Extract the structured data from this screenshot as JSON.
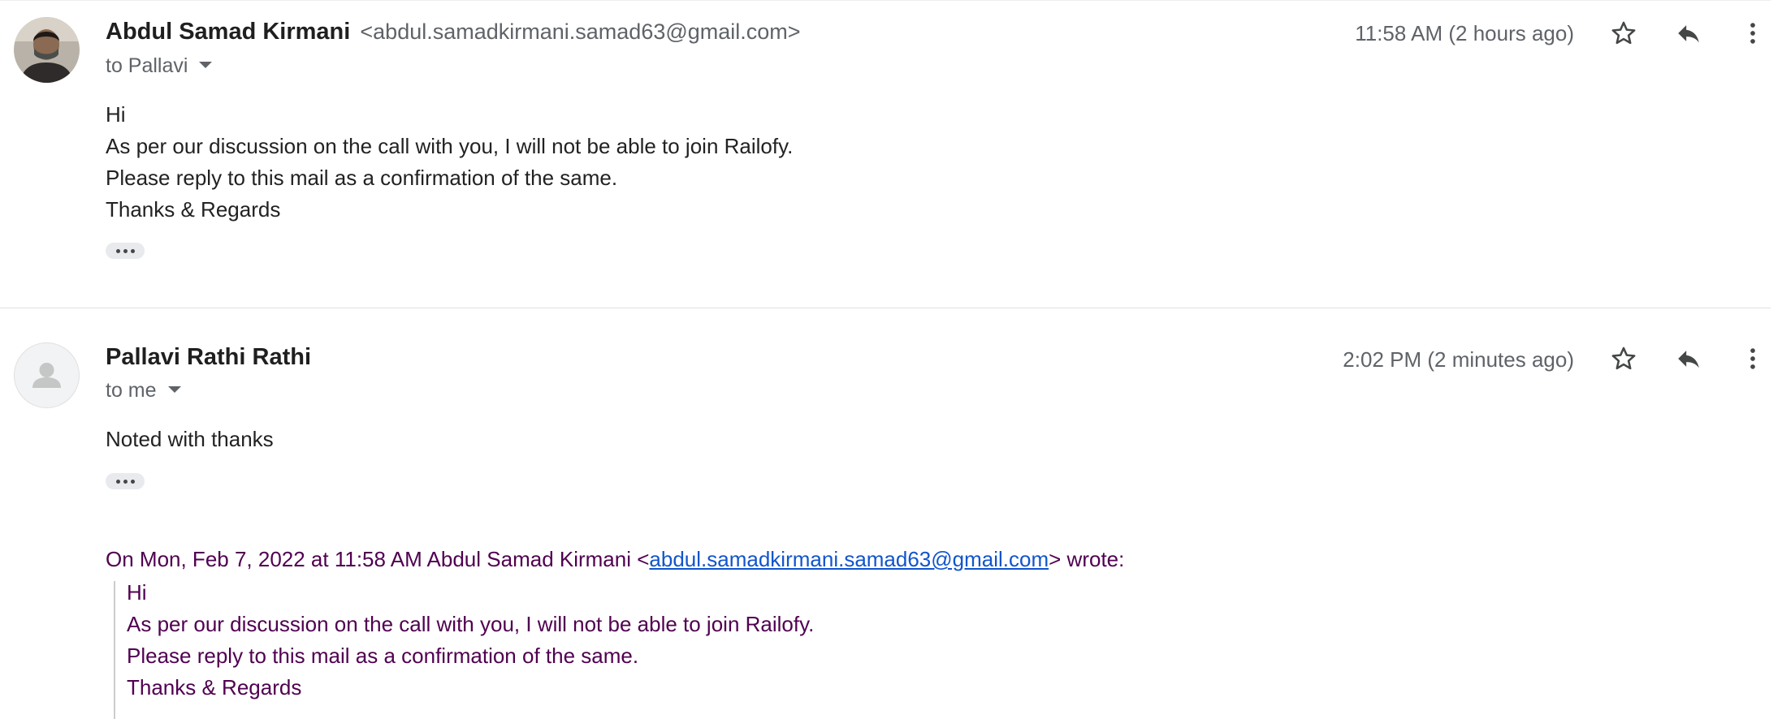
{
  "messages": [
    {
      "sender_name": "Abdul Samad Kirmani",
      "sender_email": "<abdul.samadkirmani.samad63@gmail.com>",
      "recipient_label": "to Pallavi",
      "timestamp": "11:58 AM (2 hours ago)",
      "body": [
        "Hi",
        "As per our discussion on the call with you, I will not be able to join Railofy.",
        "Please reply to this mail as a confirmation of the same.",
        "Thanks & Regards"
      ]
    },
    {
      "sender_name": "Pallavi Rathi Rathi",
      "recipient_label": "to me",
      "timestamp": "2:02 PM (2 minutes ago)",
      "body": [
        "Noted with thanks"
      ],
      "quote": {
        "header_prefix": "On Mon, Feb 7, 2022 at 11:58 AM Abdul Samad Kirmani <",
        "header_link": "abdul.samadkirmani.samad63@gmail.com",
        "header_suffix": "> wrote:",
        "lines": [
          "Hi",
          "As per our discussion on the call with you, I will not be able to join Railofy.",
          "Please reply to this mail as a confirmation of the same.",
          "Thanks & Regards"
        ]
      }
    }
  ],
  "icons": {
    "star": "star-outline-icon",
    "reply": "reply-icon",
    "more": "more-vertical-icon",
    "expand": "show-trimmed-content-icon"
  },
  "colors": {
    "quote_text": "#500050",
    "link": "#1155cc",
    "secondary_text": "#5f6368"
  }
}
